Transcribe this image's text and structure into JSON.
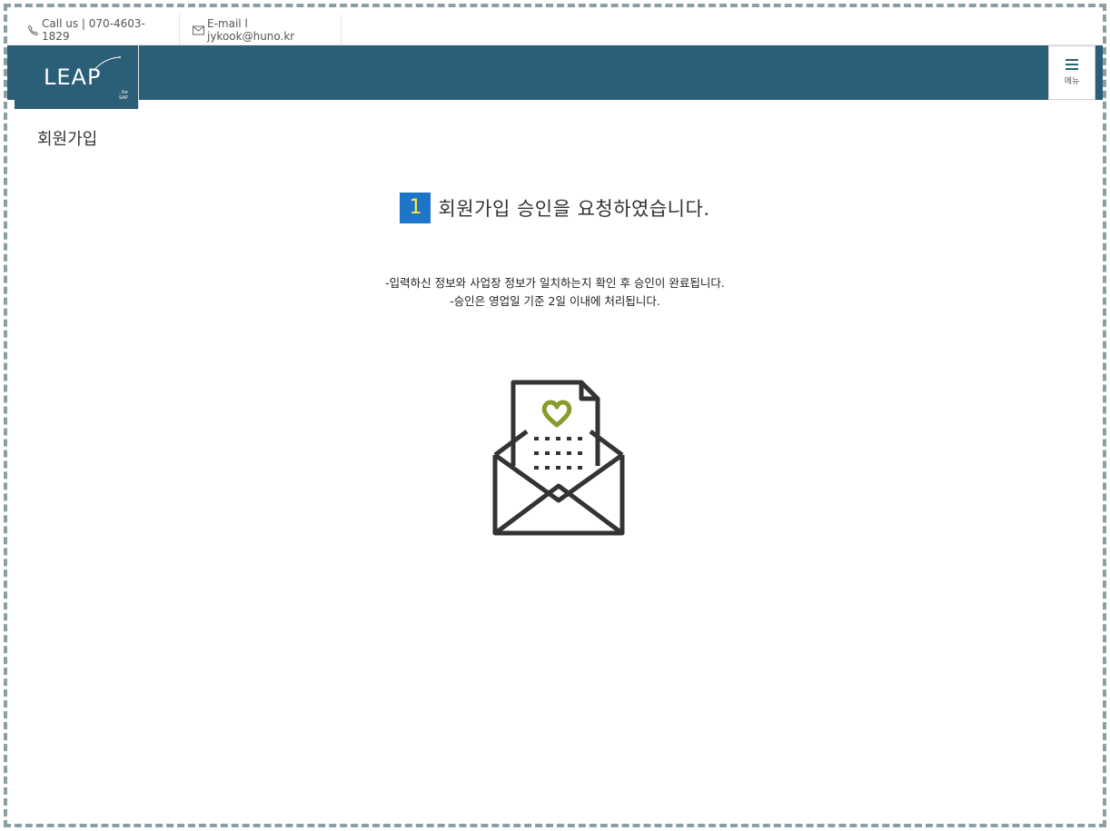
{
  "topbar": {
    "phone": "Call us | 070-4603-1829",
    "email": "E-mail l jykook@huno.kr"
  },
  "header": {
    "logo_text": "LEAP",
    "logo_sub": "..for SAP",
    "menu_label": "메뉴"
  },
  "page": {
    "title": "회원가입"
  },
  "message": {
    "number": "1",
    "heading": "회원가입 승인을 요청하였습니다.",
    "note_1": "-입력하신 정보와 사업장 정보가 일치하는지 확인 후 승인이 완료됩니다.",
    "note_2": "-승인은 영업일 기준 2일 이내에 처리됩니다."
  },
  "colors": {
    "header_bg": "#2b5f78",
    "badge_bg": "#1e74c8",
    "badge_text": "#ffeb3b",
    "heart": "#8a9a2b",
    "envelope_stroke": "#333333"
  },
  "icons": {
    "phone": "phone-icon",
    "email": "mail-icon",
    "menu": "hamburger-icon",
    "illustration": "envelope-letter-heart-icon"
  }
}
